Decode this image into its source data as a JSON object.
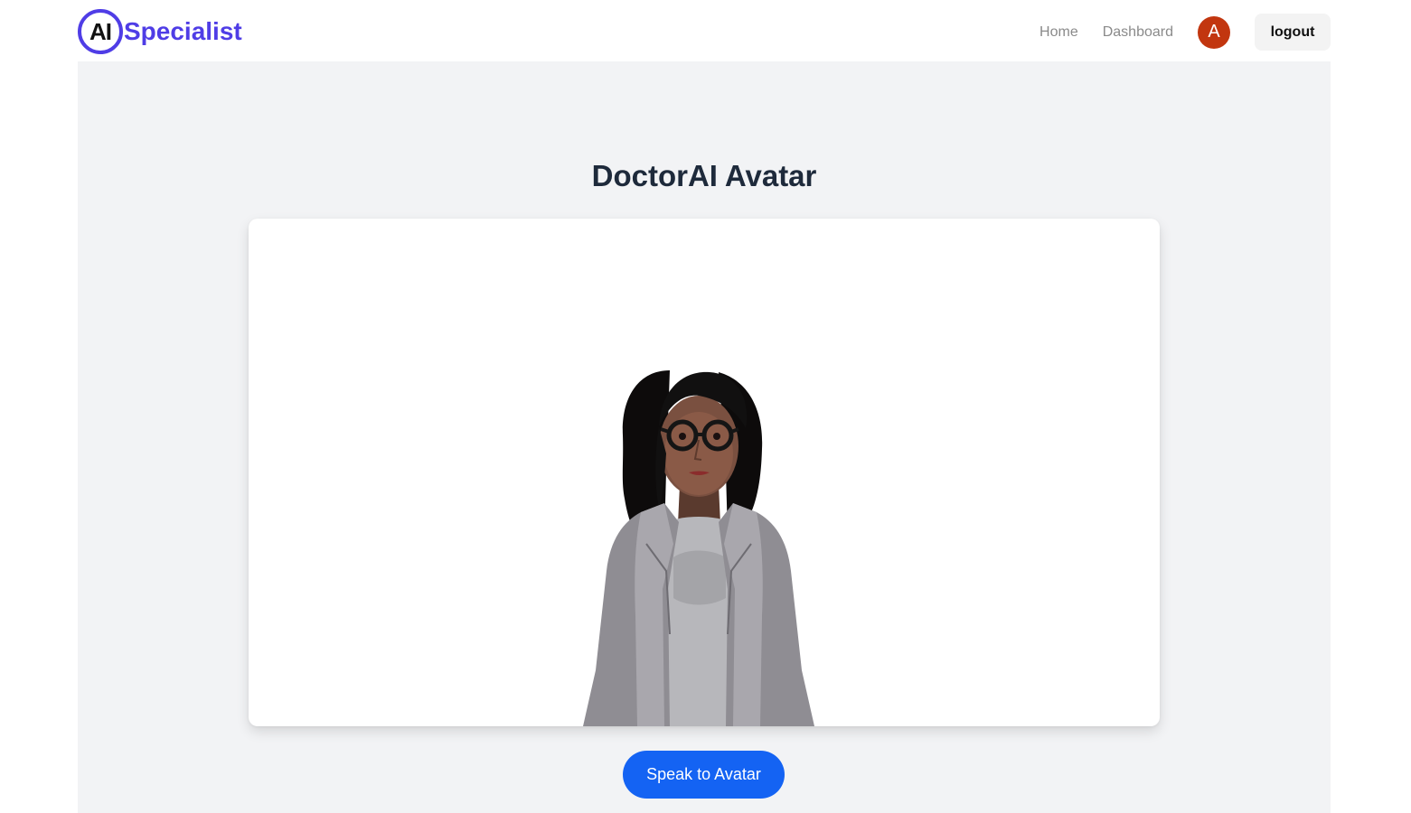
{
  "header": {
    "logo_mark": "AI",
    "logo_text": "Specialist",
    "nav": {
      "home": "Home",
      "dashboard": "Dashboard"
    },
    "user_initial": "A",
    "logout_label": "logout"
  },
  "main": {
    "title": "DoctorAI Avatar",
    "avatar_icon": "doctor-avatar-3d",
    "speak_button": "Speak to Avatar"
  },
  "colors": {
    "brand": "#4f3de6",
    "user_badge": "#c2360f",
    "primary_button": "#1463f3",
    "main_background": "#f2f3f5",
    "title_text": "#1e2a3b"
  }
}
